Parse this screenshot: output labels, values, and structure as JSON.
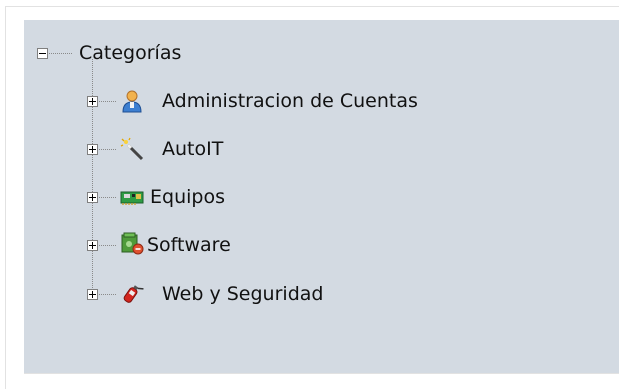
{
  "tree": {
    "root": {
      "label": "Categorías",
      "expanded": true
    },
    "items": [
      {
        "label": "Administracion de Cuentas",
        "icon": "user-account-icon"
      },
      {
        "label": "AutoIT",
        "icon": "magic-wand-icon"
      },
      {
        "label": "Equipos",
        "icon": "network-card-icon"
      },
      {
        "label": "Software",
        "icon": "software-package-icon"
      },
      {
        "label": "Web y Seguridad",
        "icon": "fire-extinguisher-icon"
      }
    ]
  },
  "colors": {
    "panel_bg": "#d3dae2",
    "text": "#111111"
  }
}
